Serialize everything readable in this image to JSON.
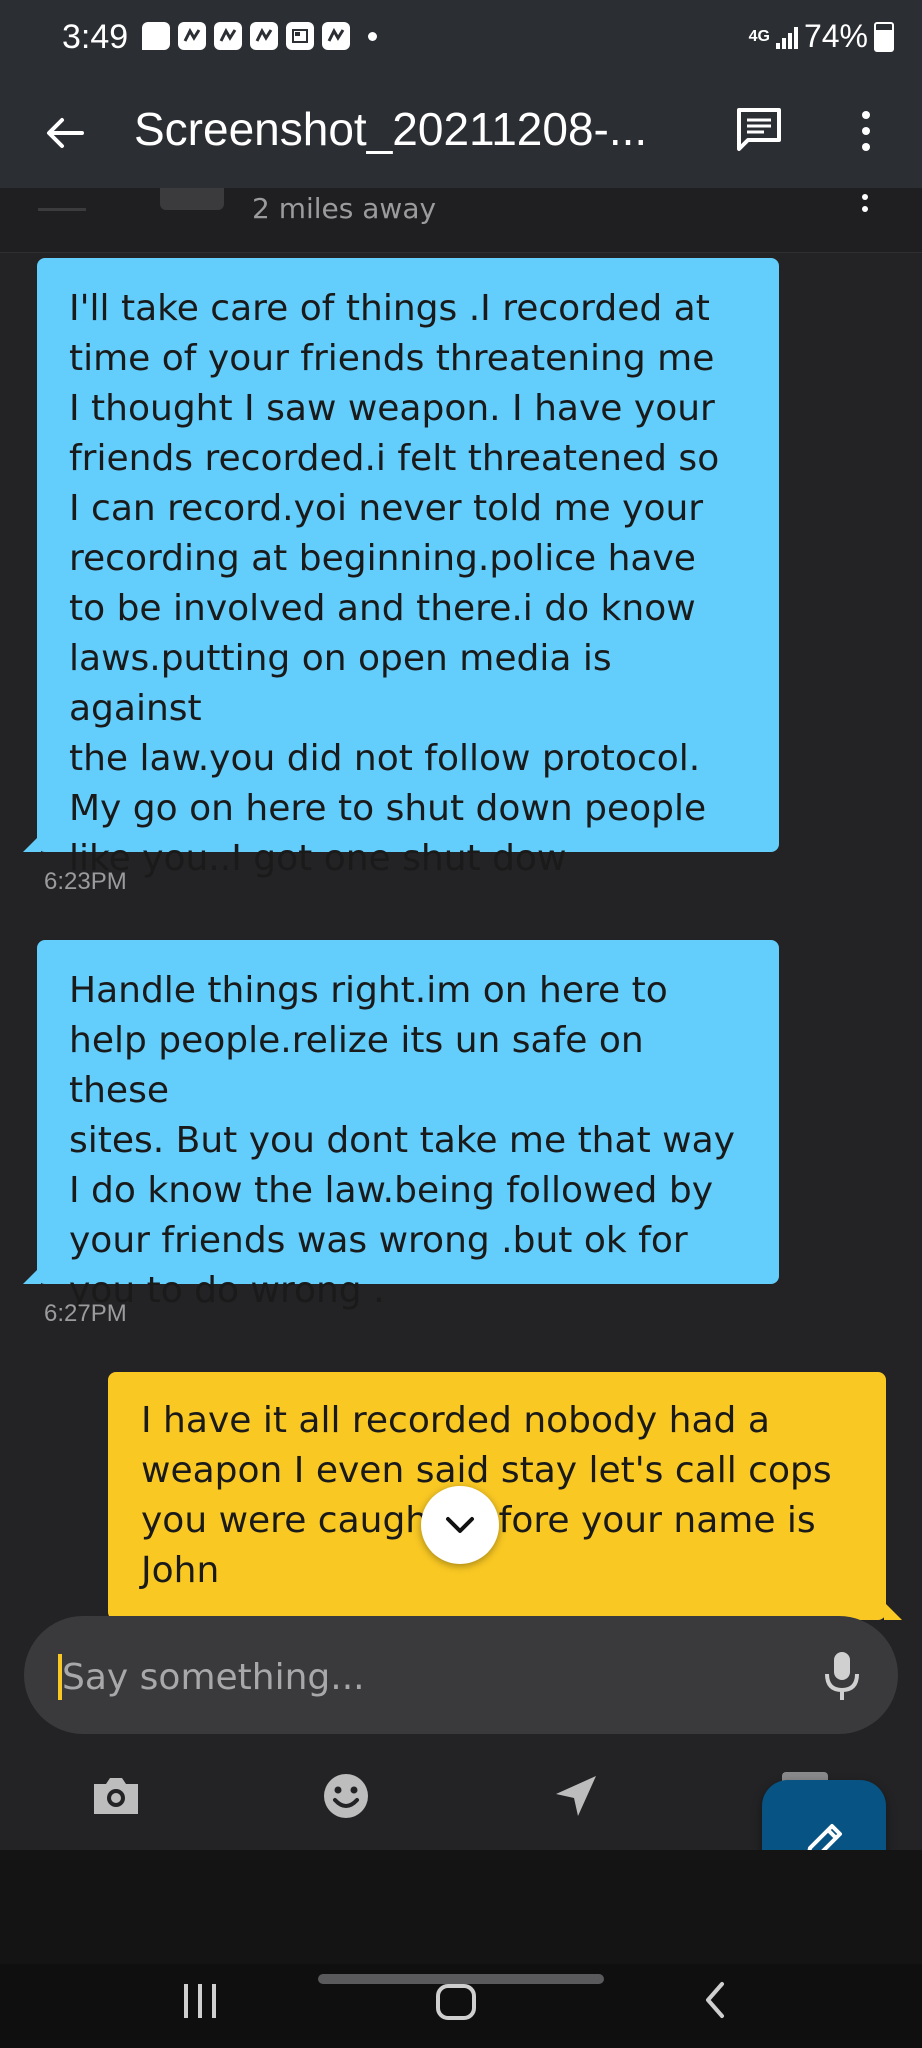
{
  "status_bar": {
    "time": "3:49",
    "network": "4G",
    "battery": "74%"
  },
  "app_bar": {
    "title": "Screenshot_20211208-..."
  },
  "profile_header": {
    "distance": "2 miles away"
  },
  "messages": [
    {
      "direction": "incoming",
      "text": "I'll   take care of things .I recorded  at\ntime of your friends  threatening me\nI thought I saw weapon. I have your\nfriends recorded.i felt threatened  so\nI can record.yoi never told me your\nrecording at beginning.police have\nto be involved and there.i do know\nlaws.putting on  open media is against\nthe law.you did not follow protocol.\nMy go on here to shut down people\nlike you..I got one  shut dow",
      "timestamp": "6:23PM"
    },
    {
      "direction": "incoming",
      "text": "Handle things right.im on here to\nhelp people.relize its un safe on these\nsites.  But you dont take me that way\nI do know the law.being followed by\nyour friends was wrong  .but ok for\nyou to do wrong .",
      "timestamp": "6:27PM"
    },
    {
      "direction": "outgoing",
      "text": "I have it all recorded nobody had a\nweapon I even said stay let's call cops\nyou were caught before your name is\nJohn"
    }
  ],
  "composer": {
    "placeholder": "Say something..."
  },
  "colors": {
    "incoming_bubble": "#63cdfb",
    "outgoing_bubble": "#f9c823",
    "background": "#232325",
    "app_bar": "#2b2e33",
    "compose_button": "#065384"
  },
  "icons": {
    "back": "arrow-left-icon",
    "chat": "chat-bubble-icon",
    "more": "more-vert-icon",
    "scroll_down": "chevron-down-icon",
    "mic": "microphone-icon",
    "camera": "camera-icon",
    "emoji": "emoji-icon",
    "location": "send-location-icon",
    "compose": "pencil-icon"
  }
}
